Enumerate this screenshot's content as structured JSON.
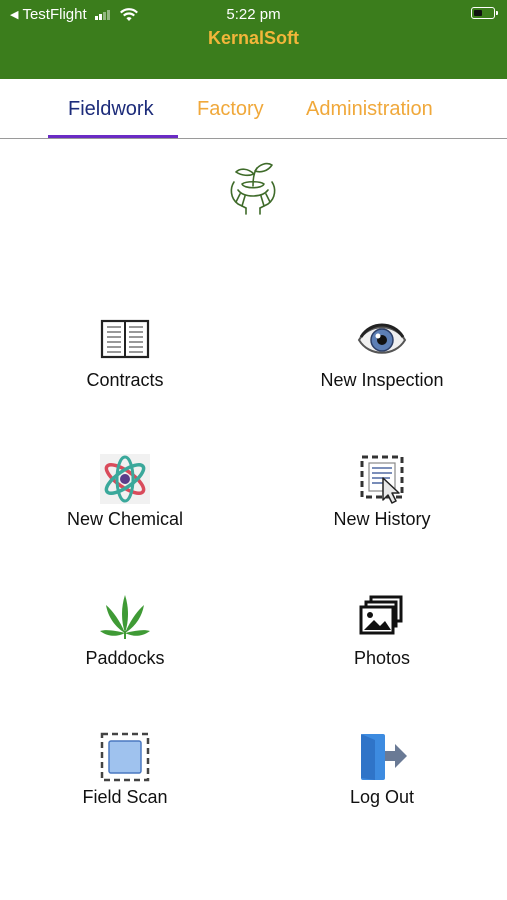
{
  "status_bar": {
    "back_label": "TestFlight",
    "time": "5:22 pm"
  },
  "header": {
    "title": "KernalSoft"
  },
  "colors": {
    "header_bg": "#3b7d1c",
    "title": "#f2b63a",
    "tab_active": "#1d2c7a",
    "tab_inactive": "#f0a83a",
    "tab_indicator": "#6a2bc4"
  },
  "tabs": [
    {
      "label": "Fieldwork",
      "active": true
    },
    {
      "label": "Factory",
      "active": false
    },
    {
      "label": "Administration",
      "active": false
    }
  ],
  "logo_icon": "hands-holding-seedling-icon",
  "menu": [
    {
      "label": "Contracts",
      "icon": "book-icon"
    },
    {
      "label": "New Inspection",
      "icon": "eye-icon"
    },
    {
      "label": "New Chemical",
      "icon": "atom-icon"
    },
    {
      "label": "New History",
      "icon": "document-selection-icon"
    },
    {
      "label": "Paddocks",
      "icon": "leaf-icon"
    },
    {
      "label": "Photos",
      "icon": "photos-icon"
    },
    {
      "label": "Field Scan",
      "icon": "scan-square-icon"
    },
    {
      "label": "Log Out",
      "icon": "logout-door-icon"
    }
  ]
}
